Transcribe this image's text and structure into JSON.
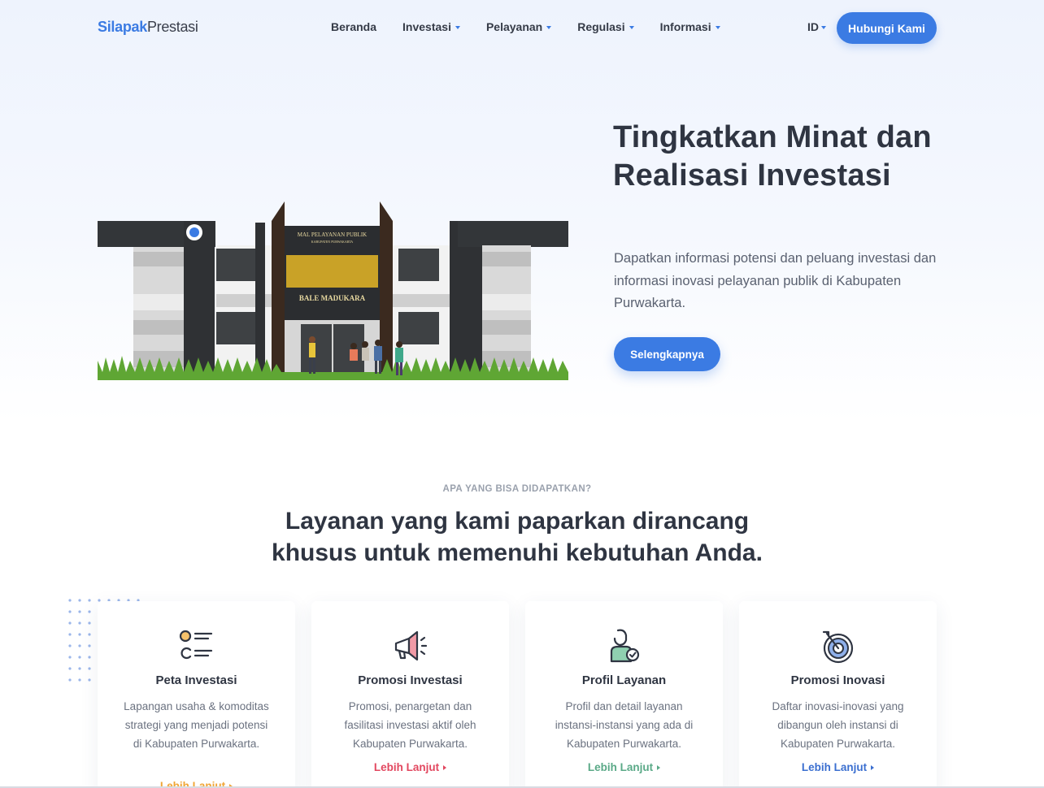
{
  "nav": {
    "logo_part1": "Silapak",
    "logo_part2": "Prestasi",
    "items": [
      "Beranda",
      "Investasi",
      "Pelayanan",
      "Regulasi",
      "Informasi"
    ],
    "lang": "ID",
    "contact_button": "Hubungi Kami"
  },
  "hero": {
    "title": "Tingkatkan Minat dan Realisasi Investasi",
    "description": "Dapatkan informasi potensi dan peluang investasi dan informasi inovasi pelayanan publik di Kabupaten Purwakarta.",
    "button": "Selengkapnya",
    "building_sign_top": "MAL PELAYANAN PUBLIK",
    "building_sign_sub": "KABUPATEN PURWAKARTA",
    "building_name": "BALE MADUKARA"
  },
  "services": {
    "eyebrow": "APA YANG BISA DIDAPATKAN?",
    "title_line1": "Layanan yang kami paparkan dirancang",
    "title_line2": "khusus untuk memenuhi kebutuhan Anda.",
    "cards": [
      {
        "title": "Peta Investasi",
        "desc": "Lapangan usaha & komoditas strategi yang menjadi potensi di Kabupaten Purwakarta.",
        "link": "Lebih Lanjut",
        "color": "#f0a535"
      },
      {
        "title": "Promosi Investasi",
        "desc": "Promosi, penargetan dan fasilitasi investasi aktif oleh Kabupaten Purwakarta.",
        "link": "Lebih Lanjut",
        "color": "#e2475f"
      },
      {
        "title": "Profil Layanan",
        "desc": "Profil dan detail layanan instansi-instansi yang ada di Kabupaten Purwakarta.",
        "link": "Lebih Lanjut",
        "color": "#5aa987"
      },
      {
        "title": "Promosi Inovasi",
        "desc": "Daftar inovasi-inovasi yang dibangun oleh instansi di Kabupaten Purwakarta.",
        "link": "Lebih Lanjut",
        "color": "#3b6fd0"
      }
    ]
  },
  "colors": {
    "accent": "#3b7be3",
    "heading": "#2f3542"
  }
}
